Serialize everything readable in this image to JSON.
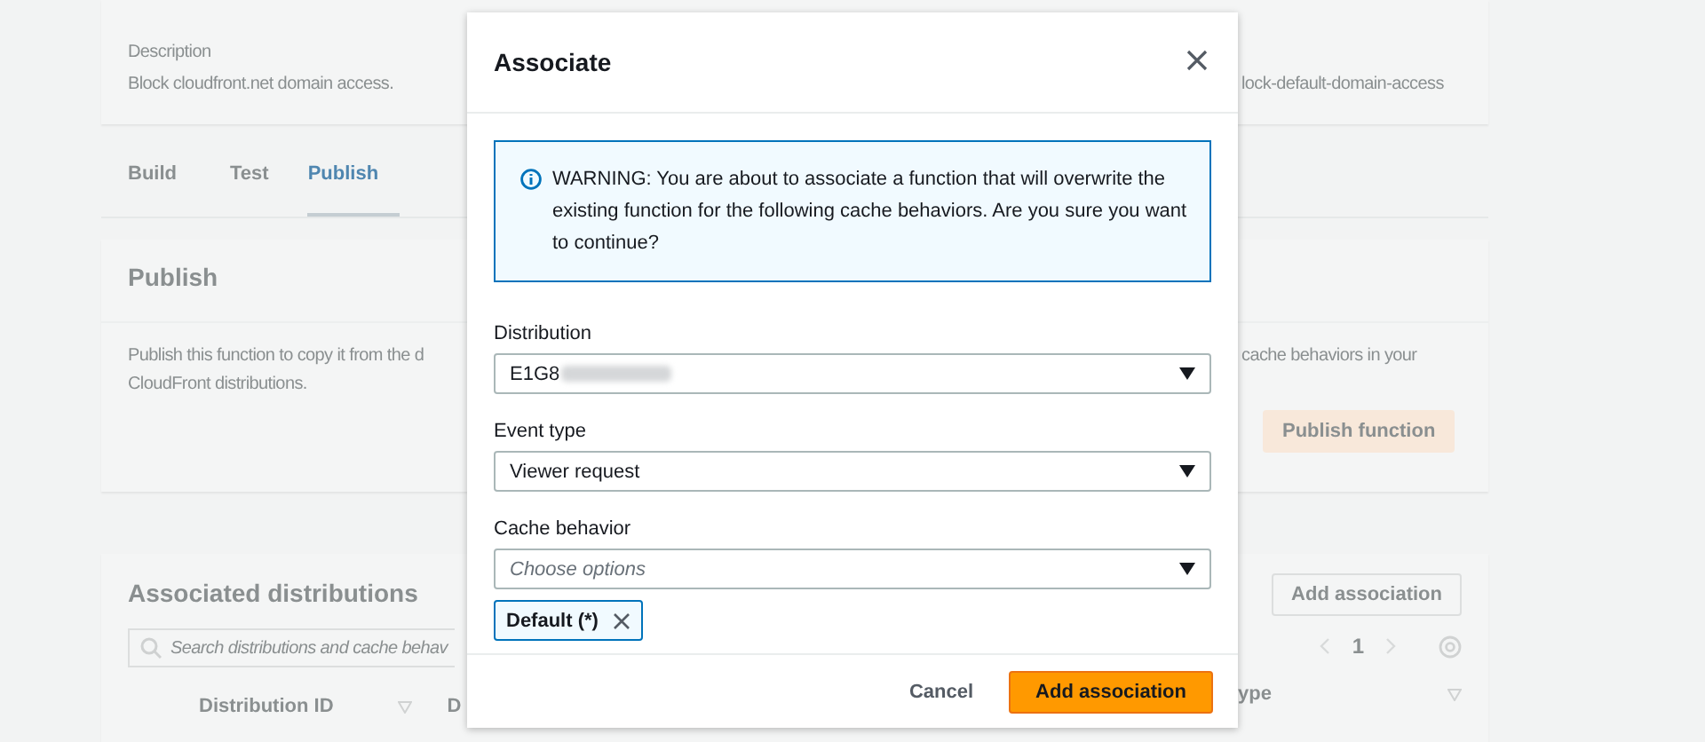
{
  "details": {
    "description_label": "Description",
    "description": "Block cloudfront.net domain access.",
    "value_right": "lock-default-domain-access"
  },
  "tabs": [
    {
      "label": "Build",
      "selected": false
    },
    {
      "label": "Test",
      "selected": false
    },
    {
      "label": "Publish",
      "selected": true
    }
  ],
  "publish": {
    "title": "Publish",
    "left_lines": [
      "Publish this function to copy it from the d",
      "CloudFront distributions."
    ],
    "right_lines": [
      "cache behaviors in your"
    ],
    "button": "Publish function"
  },
  "associated": {
    "title": "Associated distributions",
    "search_placeholder": "Search distributions and cache behav",
    "add_button": "Add association",
    "page": "1",
    "columns_left": [
      "Distribution ID",
      "D"
    ],
    "column_right": "ype"
  },
  "modal": {
    "title": "Associate",
    "warning": "WARNING: You are about to associate a function that will overwrite the existing function for the following cache behaviors. Are you sure you want to continue?",
    "fields": [
      {
        "label": "Distribution",
        "value": "E1G8",
        "redacted": true
      },
      {
        "label": "Event type",
        "value": "Viewer request",
        "redacted": false
      },
      {
        "label": "Cache behavior",
        "placeholder": "Choose options",
        "redacted": false
      }
    ],
    "tokens": [
      "Default (*)"
    ],
    "cancel": "Cancel",
    "submit": "Add association"
  }
}
